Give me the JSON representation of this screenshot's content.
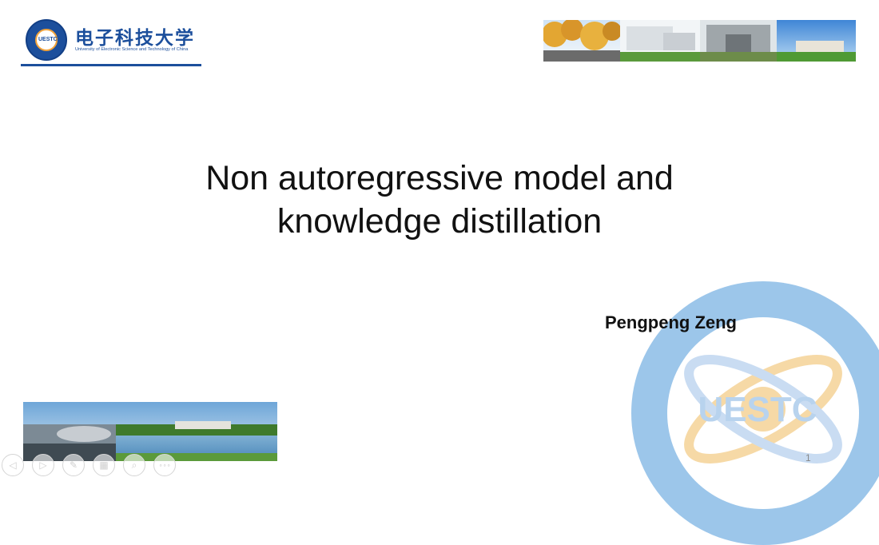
{
  "logo": {
    "chinese_name": "电子科技大学",
    "english_name": "University of Electronic Science and Technology of China",
    "seal_text": "UESTC",
    "color": "#1c4f9c"
  },
  "slide": {
    "title_line1": "Non autoregressive model and",
    "title_line2": "knowledge distillation",
    "author": "Pengpeng Zeng",
    "page_number": "1"
  },
  "watermark": {
    "text": "UESTC",
    "color": "#9cc6ea"
  },
  "controls": [
    {
      "name": "previous-slide-button",
      "icon": "arrow-left-icon",
      "glyph": "◁"
    },
    {
      "name": "next-slide-button",
      "icon": "arrow-right-icon",
      "glyph": "▷"
    },
    {
      "name": "pen-tool-button",
      "icon": "pen-icon",
      "glyph": "✎"
    },
    {
      "name": "slides-overview-button",
      "icon": "grid-icon",
      "glyph": "▦"
    },
    {
      "name": "zoom-button",
      "icon": "magnifier-icon",
      "glyph": "⌕"
    },
    {
      "name": "more-options-button",
      "icon": "ellipsis-icon",
      "glyph": "∘∘∘"
    }
  ]
}
